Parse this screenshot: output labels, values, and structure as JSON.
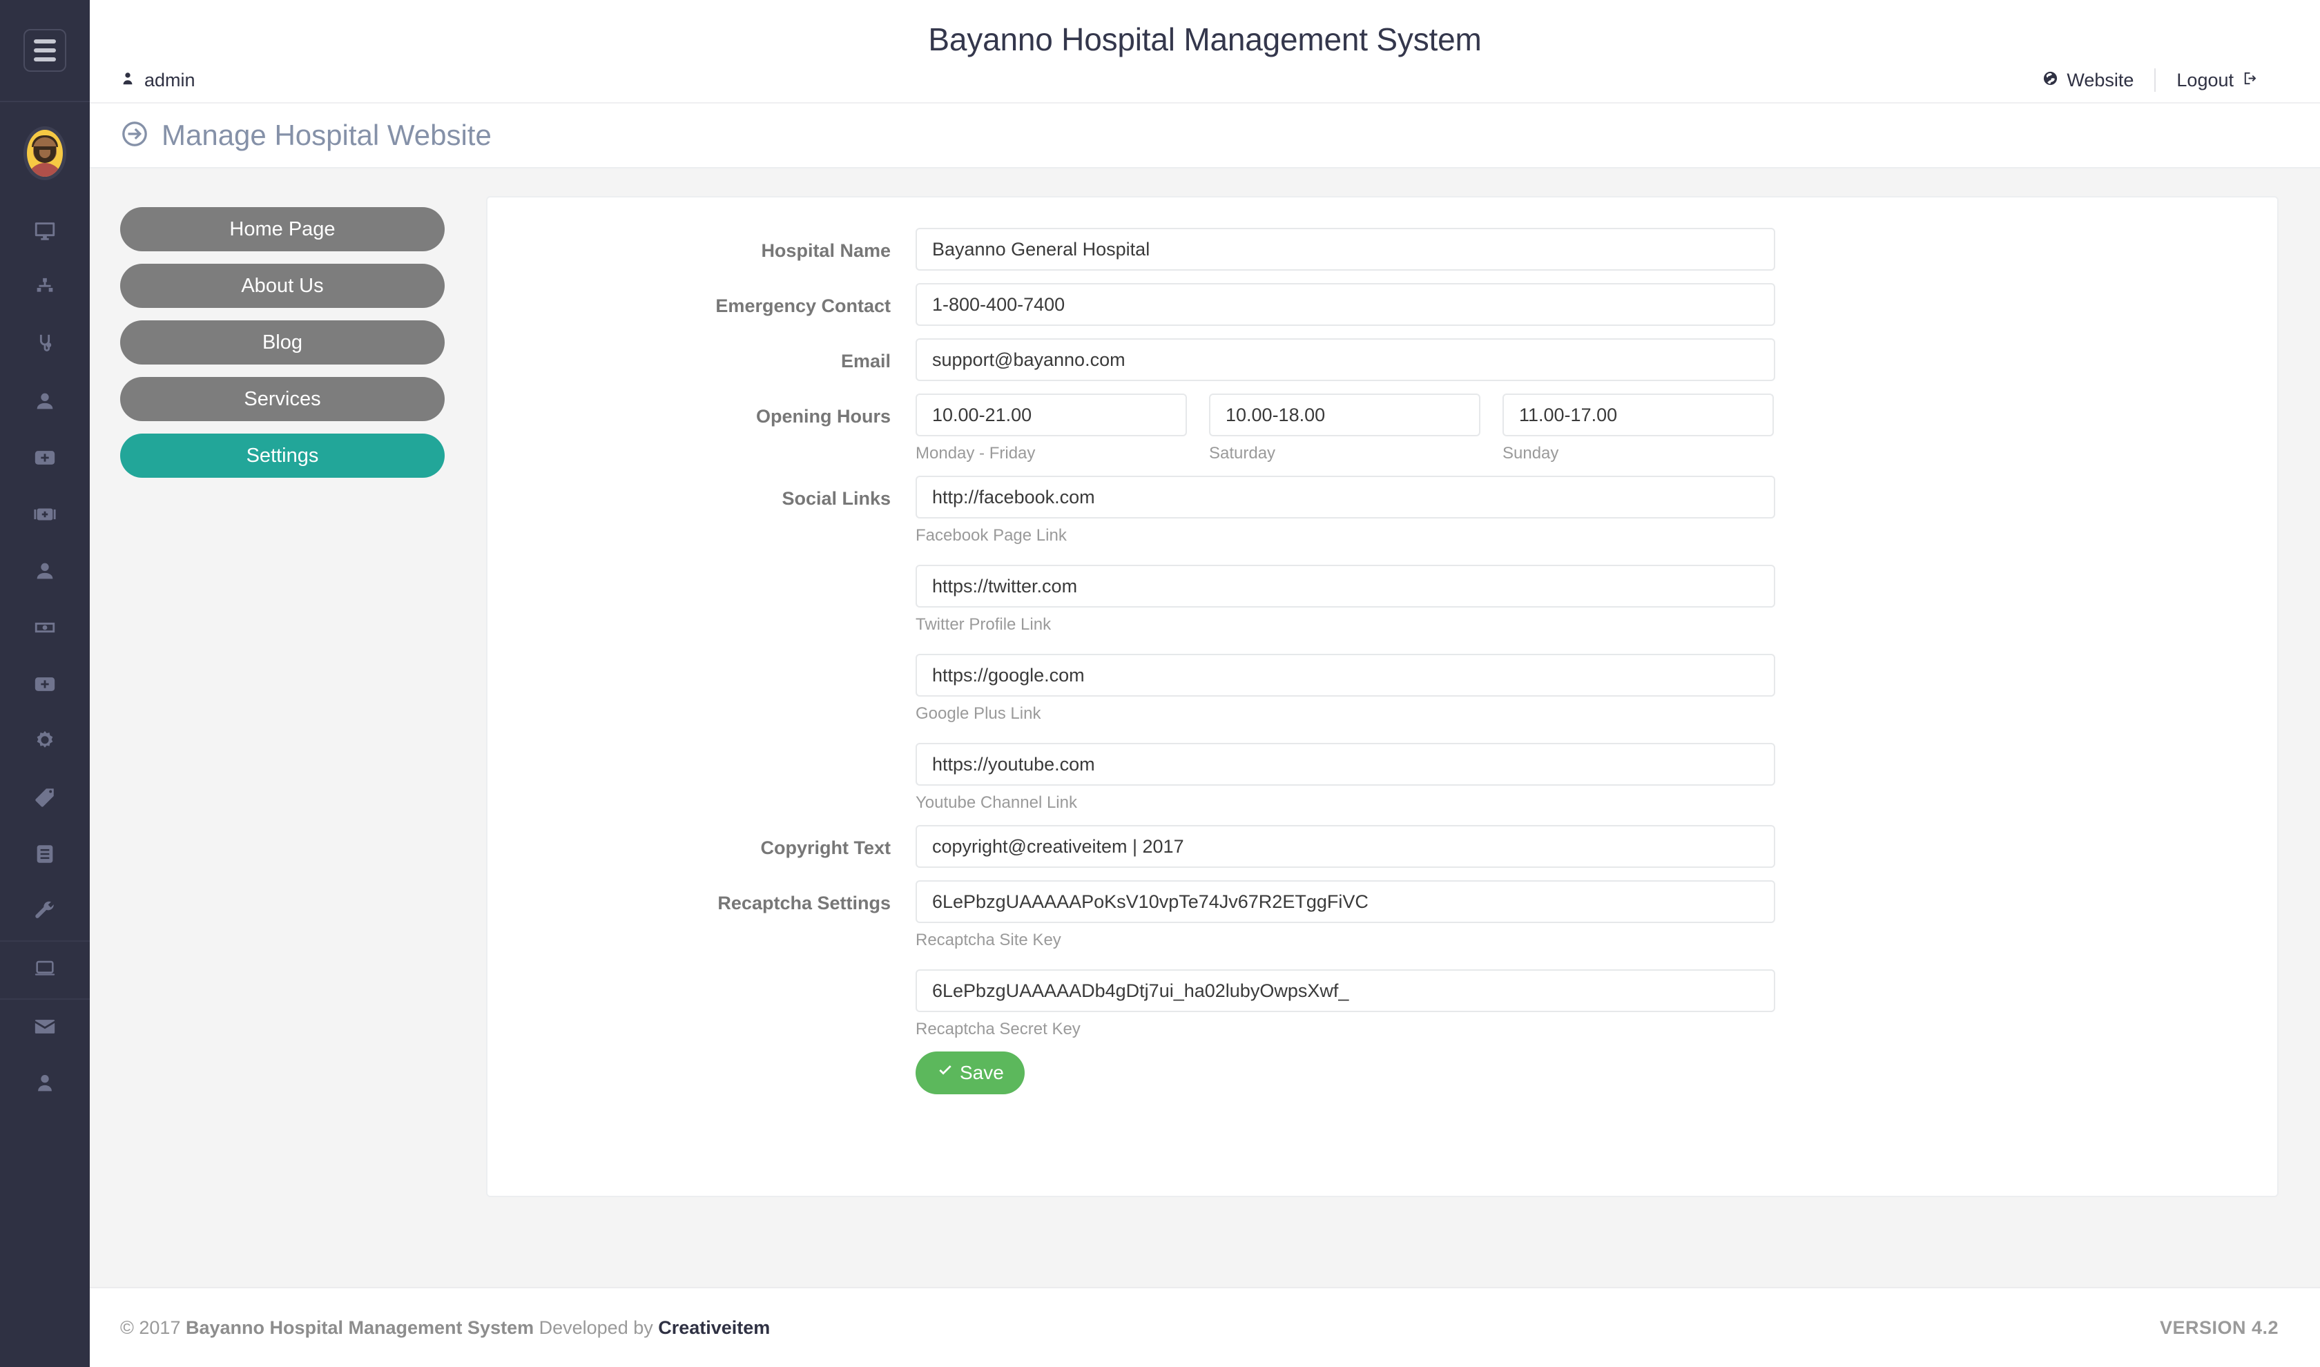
{
  "sidebar": {
    "menu_toggle": "menu-toggle",
    "avatar_label": "admin-avatar",
    "icons": [
      {
        "name": "desktop-icon"
      },
      {
        "name": "sitemap-icon"
      },
      {
        "name": "stethoscope-icon"
      },
      {
        "name": "user-icon"
      },
      {
        "name": "first-aid-plus-icon"
      },
      {
        "name": "medical-bag-icon"
      },
      {
        "name": "user-nurse-icon"
      },
      {
        "name": "money-bill-icon"
      },
      {
        "name": "first-aid-plus-icon-2"
      },
      {
        "name": "gear-icon"
      },
      {
        "name": "tag-icon"
      },
      {
        "name": "list-icon"
      },
      {
        "name": "wrench-icon"
      },
      {
        "name": "laptop-icon"
      },
      {
        "name": "envelope-icon"
      },
      {
        "name": "person-icon"
      }
    ]
  },
  "header": {
    "app_title": "Bayanno Hospital Management System",
    "admin_label": "admin",
    "website_label": "Website",
    "logout_label": "Logout"
  },
  "page": {
    "title": "Manage Hospital Website"
  },
  "tabs": [
    {
      "label": "Home Page",
      "active": false
    },
    {
      "label": "About Us",
      "active": false
    },
    {
      "label": "Blog",
      "active": false
    },
    {
      "label": "Services",
      "active": false
    },
    {
      "label": "Settings",
      "active": true
    }
  ],
  "form": {
    "hospital_name": {
      "label": "Hospital Name",
      "value": "Bayanno General Hospital"
    },
    "emergency_contact": {
      "label": "Emergency Contact",
      "value": "1-800-400-7400"
    },
    "email": {
      "label": "Email",
      "value": "support@bayanno.com"
    },
    "opening_hours": {
      "label": "Opening Hours",
      "items": [
        {
          "value": "10.00-21.00",
          "help": "Monday - Friday"
        },
        {
          "value": "10.00-18.00",
          "help": "Saturday"
        },
        {
          "value": "11.00-17.00",
          "help": "Sunday"
        }
      ]
    },
    "social_links": {
      "label": "Social Links",
      "items": [
        {
          "value": "http://facebook.com",
          "help": "Facebook Page Link"
        },
        {
          "value": "https://twitter.com",
          "help": "Twitter Profile Link"
        },
        {
          "value": "https://google.com",
          "help": "Google Plus Link"
        },
        {
          "value": "https://youtube.com",
          "help": "Youtube Channel Link"
        }
      ]
    },
    "copyright_text": {
      "label": "Copyright Text",
      "value": "copyright@creativeitem | 2017"
    },
    "recaptcha": {
      "label": "Recaptcha Settings",
      "items": [
        {
          "value": "6LePbzgUAAAAAPoKsV10vpTe74Jv67R2ETggFiVC",
          "help": "Recaptcha Site Key"
        },
        {
          "value": "6LePbzgUAAAAADb4gDtj7ui_ha02lubyOwpsXwf_",
          "help": "Recaptcha Secret Key"
        }
      ]
    },
    "save_label": "Save"
  },
  "footer": {
    "copyright_prefix": "© 2017 ",
    "copyright_brand": "Bayanno Hospital Management System",
    "copyright_mid": " Developed by ",
    "developer": "Creativeitem",
    "version": "VERSION 4.2"
  },
  "colors": {
    "sidebar_bg": "#2f3143",
    "accent_teal": "#22a699",
    "tab_gray": "#7d7d7d",
    "save_green": "#5cb85c",
    "page_title": "#8591a8"
  }
}
